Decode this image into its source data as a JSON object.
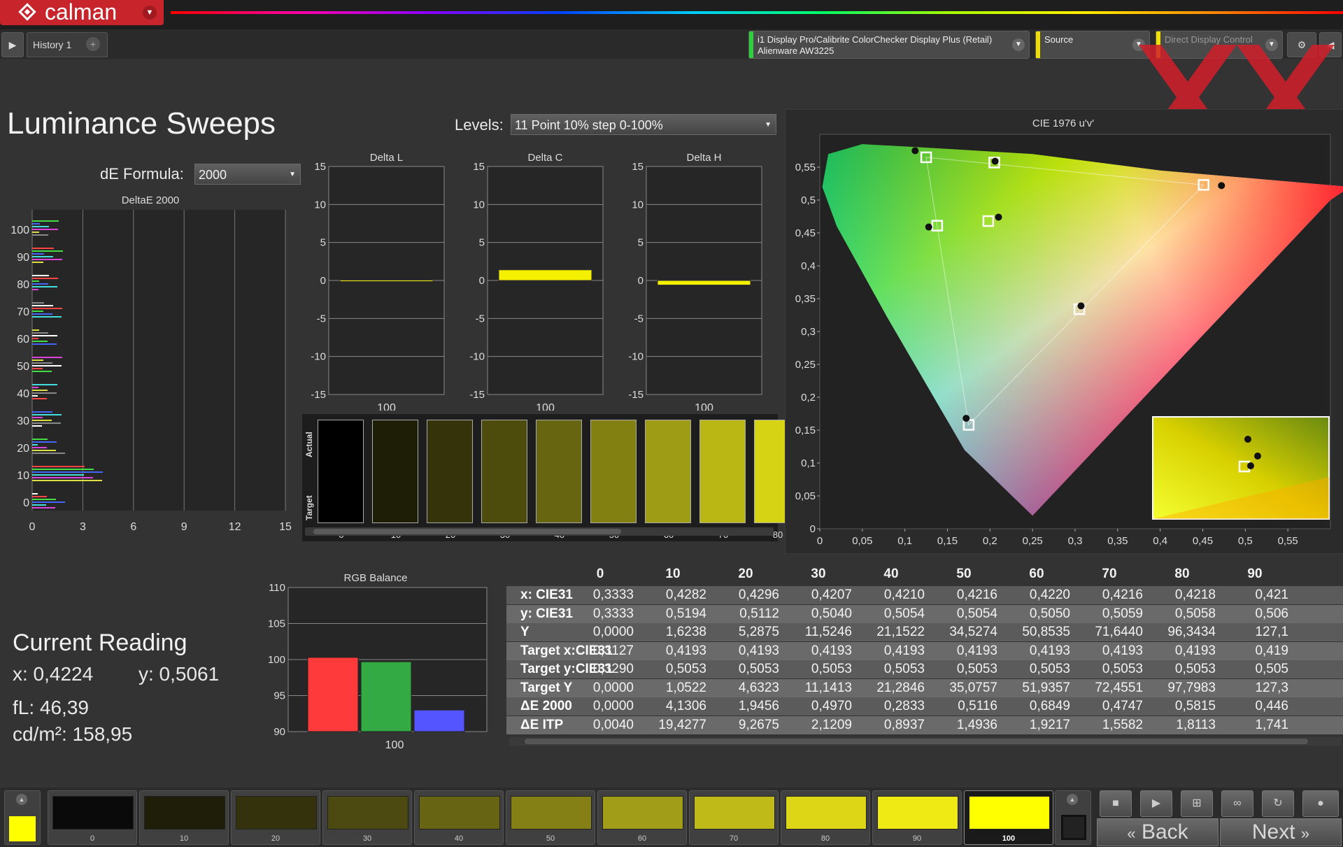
{
  "app": {
    "logo_text": "calman",
    "history_tab": "History 1",
    "history_add": "+",
    "meter_line1": "i1 Display Pro/Calibrite ColorChecker Display Plus (Retail)",
    "meter_line2": "Alienware AW3225",
    "source_label": "Source",
    "display_control_label": "Direct Display Control"
  },
  "page": {
    "title": "Luminance Sweeps",
    "levels_label": "Levels:",
    "levels_value": "11 Point 10% step 0-100%",
    "de_formula_label": "dE Formula:",
    "de_formula_value": "2000"
  },
  "deltae_chart": {
    "title": "DeltaE 2000",
    "y_ticks": [
      "100",
      "90",
      "80",
      "70",
      "60",
      "50",
      "40",
      "30",
      "20",
      "10",
      "0"
    ],
    "x_ticks": [
      "0",
      "3",
      "6",
      "9",
      "12",
      "15"
    ]
  },
  "delta_charts": [
    {
      "title": "Delta L",
      "value": 0.05,
      "x_label": "100"
    },
    {
      "title": "Delta C",
      "value": 1.4,
      "x_label": "100"
    },
    {
      "title": "Delta H",
      "value": -0.6,
      "x_label": "100"
    }
  ],
  "delta_y_ticks": [
    "15",
    "10",
    "5",
    "0",
    "-5",
    "-10",
    "-15"
  ],
  "swatches": {
    "actual_label": "Actual",
    "target_label": "Target",
    "items": [
      {
        "label": "0",
        "color": "#000000"
      },
      {
        "label": "10",
        "color": "#1e1d05"
      },
      {
        "label": "20",
        "color": "#35330a"
      },
      {
        "label": "30",
        "color": "#4e4c0d"
      },
      {
        "label": "40",
        "color": "#686510"
      },
      {
        "label": "50",
        "color": "#838012"
      },
      {
        "label": "60",
        "color": "#9e9b14"
      },
      {
        "label": "70",
        "color": "#bab614"
      },
      {
        "label": "80",
        "color": "#d6d214"
      }
    ]
  },
  "cie": {
    "title": "CIE 1976 u'v'",
    "y_ticks": [
      "0,55",
      "0,5",
      "0,45",
      "0,4",
      "0,35",
      "0,3",
      "0,25",
      "0,2",
      "0,15",
      "0,1",
      "0,05",
      "0"
    ],
    "x_ticks": [
      "0",
      "0,05",
      "0,1",
      "0,15",
      "0,2",
      "0,25",
      "0,3",
      "0,35",
      "0,4",
      "0,45",
      "0,5",
      "0,55"
    ]
  },
  "rgb_balance": {
    "title": "RGB Balance",
    "y_ticks": [
      "110",
      "105",
      "100",
      "95",
      "90"
    ],
    "x_label": "100",
    "red": 100.3,
    "green": 99.7,
    "blue": 93.0
  },
  "current_reading": {
    "title": "Current Reading",
    "x": "x: 0,4224",
    "y": "y: 0,5061",
    "fl": "fL: 46,39",
    "cdm2": "cd/m²: 158,95"
  },
  "table": {
    "columns": [
      "0",
      "10",
      "20",
      "30",
      "40",
      "50",
      "60",
      "70",
      "80",
      "90"
    ],
    "rows": [
      {
        "label": "x: CIE31",
        "values": [
          "0,3333",
          "0,4282",
          "0,4296",
          "0,4207",
          "0,4210",
          "0,4216",
          "0,4220",
          "0,4216",
          "0,4218",
          "0,421"
        ]
      },
      {
        "label": "y: CIE31",
        "values": [
          "0,3333",
          "0,5194",
          "0,5112",
          "0,5040",
          "0,5054",
          "0,5054",
          "0,5050",
          "0,5059",
          "0,5058",
          "0,506"
        ]
      },
      {
        "label": "Y",
        "values": [
          "0,0000",
          "1,6238",
          "5,2875",
          "11,5246",
          "21,1522",
          "34,5274",
          "50,8535",
          "71,6440",
          "96,3434",
          "127,1"
        ]
      },
      {
        "label": "Target x:CIE31",
        "values": [
          "0,3127",
          "0,4193",
          "0,4193",
          "0,4193",
          "0,4193",
          "0,4193",
          "0,4193",
          "0,4193",
          "0,4193",
          "0,419"
        ]
      },
      {
        "label": "Target y:CIE31",
        "values": [
          "0,3290",
          "0,5053",
          "0,5053",
          "0,5053",
          "0,5053",
          "0,5053",
          "0,5053",
          "0,5053",
          "0,5053",
          "0,505"
        ]
      },
      {
        "label": "Target Y",
        "values": [
          "0,0000",
          "1,0522",
          "4,6323",
          "11,1413",
          "21,2846",
          "35,0757",
          "51,9357",
          "72,4551",
          "97,7983",
          "127,3"
        ]
      },
      {
        "label": "ΔE 2000",
        "values": [
          "0,0000",
          "4,1306",
          "1,9456",
          "0,4970",
          "0,2833",
          "0,5116",
          "0,6849",
          "0,4747",
          "0,5815",
          "0,446"
        ]
      },
      {
        "label": "ΔE ITP",
        "values": [
          "0,0040",
          "19,4277",
          "9,2675",
          "2,1209",
          "0,8937",
          "1,4936",
          "1,9217",
          "1,5582",
          "1,8113",
          "1,741"
        ]
      }
    ]
  },
  "bottom": {
    "swatches": [
      {
        "label": "0",
        "color": "#0a0a0a"
      },
      {
        "label": "10",
        "color": "#1f1e08"
      },
      {
        "label": "20",
        "color": "#34320c"
      },
      {
        "label": "30",
        "color": "#4c4a10"
      },
      {
        "label": "40",
        "color": "#676413"
      },
      {
        "label": "50",
        "color": "#848016"
      },
      {
        "label": "60",
        "color": "#a19d18"
      },
      {
        "label": "70",
        "color": "#bfba18"
      },
      {
        "label": "80",
        "color": "#dcd617"
      },
      {
        "label": "90",
        "color": "#efea14"
      },
      {
        "label": "100",
        "color": "#ffff00"
      }
    ],
    "back_label": "Back",
    "next_label": "Next"
  },
  "colors": {
    "accent_red": "#c8242b",
    "meter_bar": "#2ccf3c",
    "source_bar": "#f0e000",
    "delta_bar": "#f5f000"
  }
}
